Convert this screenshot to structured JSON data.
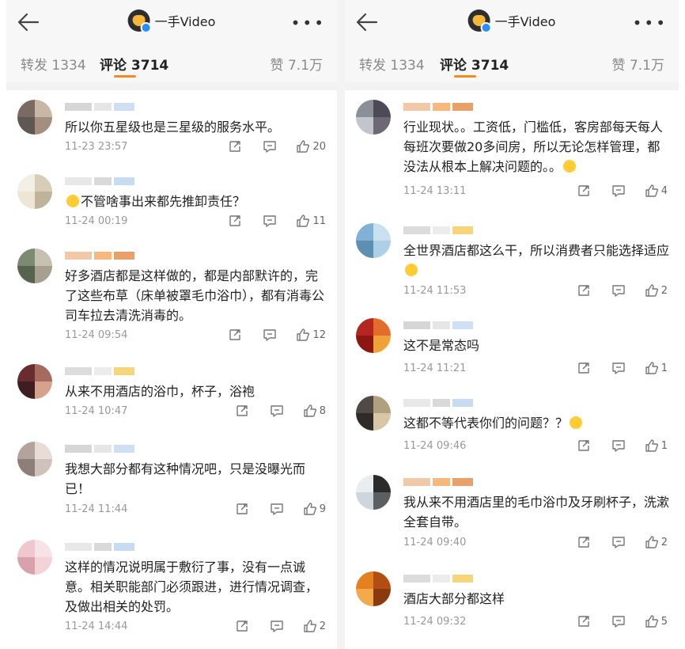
{
  "app": {
    "author_name": "一手Video"
  },
  "tabs": {
    "repost": "转发 1334",
    "comments": "评论 3714",
    "likes": "赞 7.1万"
  },
  "colors": {
    "accent": "#f58b1f",
    "text": "#222222",
    "meta": "#999999",
    "nav_bg": "#f7f7f7"
  },
  "icons": {
    "back": "back-arrow-icon",
    "more": "more-dots-icon",
    "share": "share-icon",
    "reply": "comment-icon",
    "like": "thumbs-up-icon"
  },
  "left_comments": [
    {
      "text": "所以你五星级也是三星级的服务水平。",
      "time": "11-23 23:57",
      "likes": "20"
    },
    {
      "text": "不管啥事出来都先推卸责任？",
      "time": "11-24 00:19",
      "likes": "11",
      "emoji_prefix": true
    },
    {
      "text": "好多酒店都是这样做的，都是内部默许的，完了这些布草（床单被罩毛巾浴巾），都有消毒公司车拉去清洗消毒的。",
      "time": "11-24 09:54",
      "likes": "12"
    },
    {
      "text": "从来不用酒店的浴巾，杯子，浴袍",
      "time": "11-24 10:47",
      "likes": "8"
    },
    {
      "text": "我想大部分都有这种情况吧，只是没曝光而已！",
      "time": "11-24 11:44",
      "likes": "9"
    },
    {
      "text": "这样的情况说明属于敷衍了事，没有一点诚意。相关职能部门必须跟进，进行情况调查，及做出相关的处罚。",
      "time": "11-24 14:44",
      "likes": "2"
    }
  ],
  "right_comments": [
    {
      "text": "行业现状。。工资低，门槛低，客房部每天每人每班次要做20多间房，所以无论怎样管理，都没法从根本上解决问题的。。",
      "time": "11-24 13:11",
      "likes": "4",
      "emoji_suffix": true
    },
    {
      "text": "全世界酒店都这么干，所以消费者只能选择适应",
      "time": "11-24 11:53",
      "likes": "2",
      "emoji_suffix": true
    },
    {
      "text": "这不是常态吗",
      "time": "11-24 11:21",
      "likes": "1"
    },
    {
      "text": "这都不等代表你们的问题？？",
      "time": "11-24 09:46",
      "likes": "1",
      "emoji_suffix": true
    },
    {
      "text": "我从来不用酒店里的毛巾浴巾及牙刷杯子，洗漱全套自带。",
      "time": "11-24 09:40",
      "likes": "2"
    },
    {
      "text": "酒店大部分都这样",
      "time": "11-24 09:32",
      "likes": "5"
    }
  ]
}
